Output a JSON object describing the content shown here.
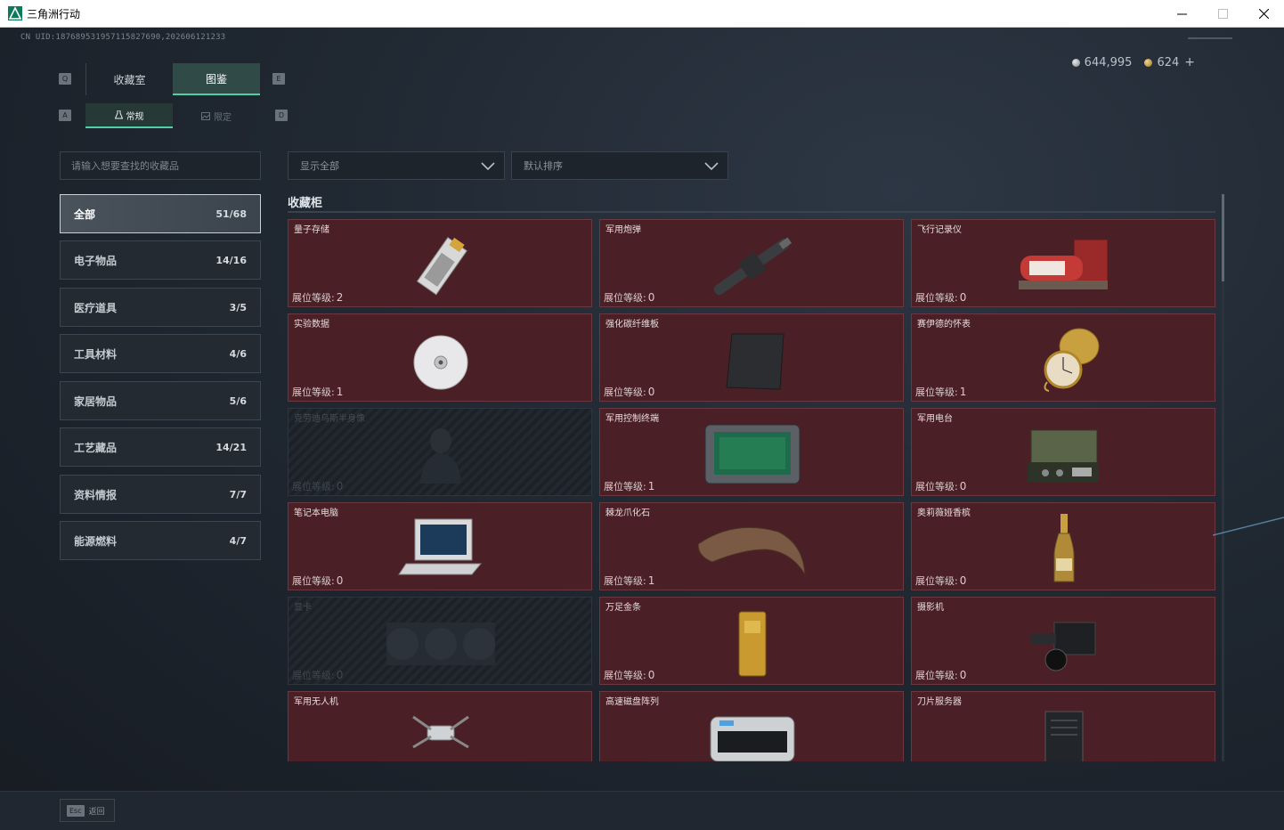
{
  "window": {
    "title": "三角洲行动",
    "minimize": "minimize",
    "maximize": "maximize",
    "close": "close"
  },
  "header": {
    "uid": "CN UID:18768953195711582769​0,202606121233",
    "currency_silver": "644,995",
    "currency_gold": "624",
    "plus": "+"
  },
  "keys": {
    "q": "Q",
    "e": "E",
    "a": "A",
    "d": "D",
    "esc": "Esc"
  },
  "tabs": [
    {
      "label": "收藏室"
    },
    {
      "label": "图鉴"
    }
  ],
  "subtabs": [
    {
      "label": "常规"
    },
    {
      "label": "限定"
    }
  ],
  "search": {
    "placeholder": "请输入想要查找的收藏品"
  },
  "filters": {
    "show": "显示全部",
    "sort": "默认排序"
  },
  "categories": [
    {
      "label": "全部",
      "count": "51/68"
    },
    {
      "label": "电子物品",
      "count": "14/16"
    },
    {
      "label": "医疗道具",
      "count": "3/5"
    },
    {
      "label": "工具材料",
      "count": "4/6"
    },
    {
      "label": "家居物品",
      "count": "5/6"
    },
    {
      "label": "工艺藏品",
      "count": "14/21"
    },
    {
      "label": "资料情报",
      "count": "7/7"
    },
    {
      "label": "能源燃料",
      "count": "4/7"
    }
  ],
  "section": {
    "title": "收藏柜",
    "level_label": "展位等级:"
  },
  "items": [
    {
      "name": "量子存储",
      "level": "2"
    },
    {
      "name": "军用炮弹",
      "level": "0"
    },
    {
      "name": "飞行记录仪",
      "level": "0"
    },
    {
      "name": "实验数据",
      "level": "1"
    },
    {
      "name": "强化碳纤维板",
      "level": "0"
    },
    {
      "name": "赛伊德的怀表",
      "level": "1"
    },
    {
      "name": "克劳迪乌斯半身像",
      "level": "0"
    },
    {
      "name": "军用控制终端",
      "level": "1"
    },
    {
      "name": "军用电台",
      "level": "0"
    },
    {
      "name": "笔记本电脑",
      "level": "0"
    },
    {
      "name": "棘龙爪化石",
      "level": "1"
    },
    {
      "name": "奥莉薇娅香槟",
      "level": "0"
    },
    {
      "name": "显卡",
      "level": "0"
    },
    {
      "name": "万足金条",
      "level": "0"
    },
    {
      "name": "摄影机",
      "level": "0"
    },
    {
      "name": "军用无人机",
      "level": ""
    },
    {
      "name": "高速磁盘阵列",
      "level": ""
    },
    {
      "name": "刀片服务器",
      "level": ""
    }
  ],
  "footer": {
    "back": "返回"
  },
  "colors": {
    "accent": "#4fd1a5",
    "card_bg": "#4a1f25",
    "card_border": "#6b3840"
  }
}
